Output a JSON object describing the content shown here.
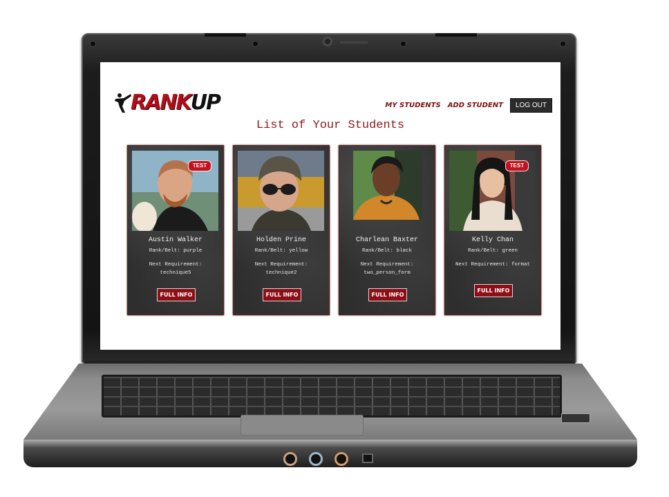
{
  "brand": {
    "logo_part1": "RANK",
    "logo_part2": "UP"
  },
  "nav": {
    "my_students": "MY STUDENTS",
    "add_student": "ADD STUDENT",
    "log_out": "LOG OUT"
  },
  "page": {
    "title": "List of Your Students"
  },
  "students": [
    {
      "name": "Austin Walker",
      "rank": "Rank/Belt: purple",
      "req_label": "Next Requirement:",
      "req_value": "technique5",
      "badge": "TEST",
      "button": "FULL INFO"
    },
    {
      "name": "Holden Prine",
      "rank": "Rank/Belt: yellow",
      "req_label": "Next Requirement:",
      "req_value": "technique2",
      "badge": "",
      "button": "FULL INFO"
    },
    {
      "name": "Charlean Baxter",
      "rank": "Rank/Belt: black",
      "req_label": "Next Requirement:",
      "req_value": "two_person_form",
      "badge": "",
      "button": "FULL INFO"
    },
    {
      "name": "Kelly Chan",
      "rank": "Rank/Belt: green",
      "req_label": "Next Requirement: format",
      "req_value": "",
      "badge": "TEST",
      "button": "FULL INFO"
    }
  ],
  "colors": {
    "accent": "#8e0e16",
    "title": "#8b1a1a",
    "card_bg": "#2e2e2e"
  }
}
